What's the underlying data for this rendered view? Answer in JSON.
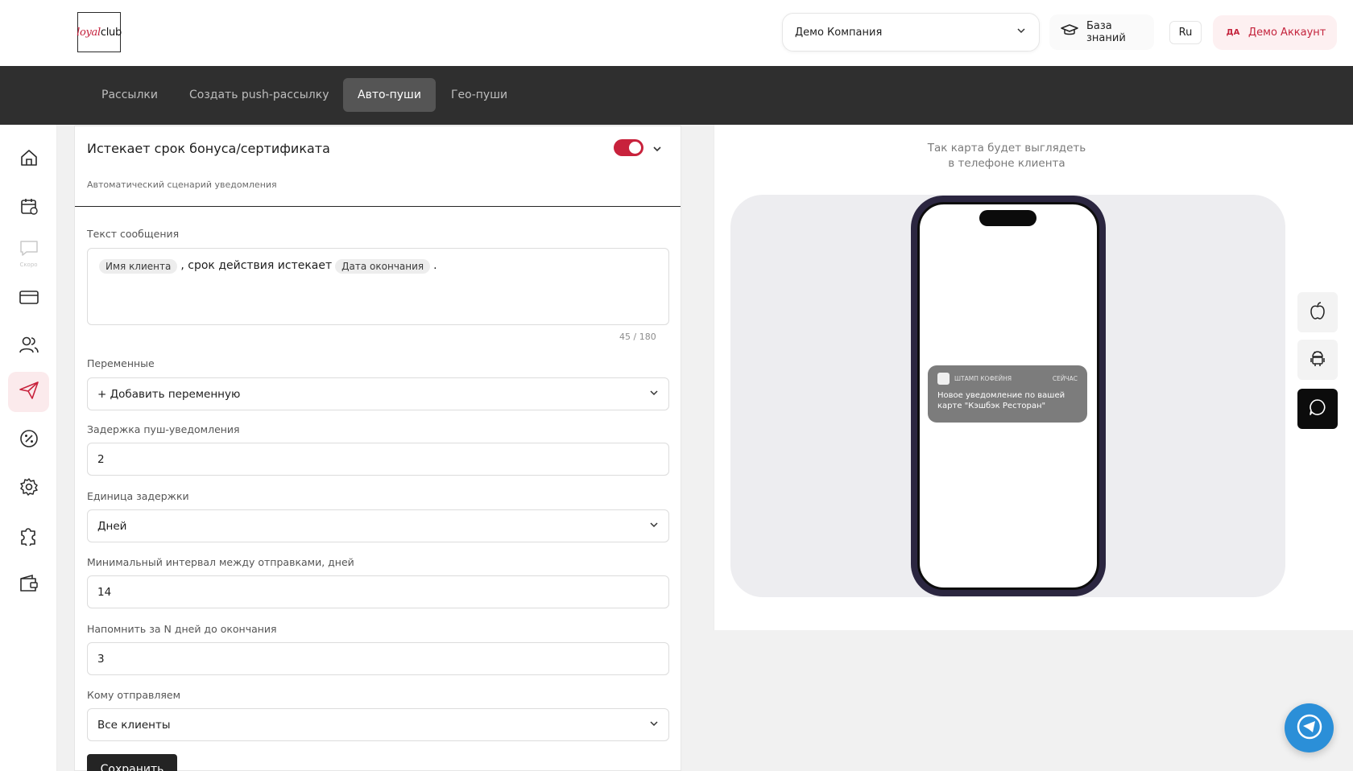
{
  "header": {
    "logo_loyal": "loyal",
    "logo_club": "club",
    "company": "Демо Компания",
    "knowledge_base": "База знаний",
    "language": "Ru",
    "account_initials": "ДА",
    "account_name": "Демо Аккаунт"
  },
  "topnav": {
    "tabs": [
      {
        "label": "Рассылки",
        "active": false
      },
      {
        "label": "Создать push-рассылку",
        "active": false
      },
      {
        "label": "Авто-пуши",
        "active": true
      },
      {
        "label": "Гео-пуши",
        "active": false
      }
    ]
  },
  "sidebar": {
    "items": [
      {
        "icon": "home-icon"
      },
      {
        "icon": "calendar-icon"
      },
      {
        "icon": "chat-icon",
        "soon_label": "Скоро"
      },
      {
        "icon": "card-icon"
      },
      {
        "icon": "users-icon"
      },
      {
        "icon": "send-icon",
        "active": true
      },
      {
        "icon": "percent-icon"
      },
      {
        "icon": "gear-icon"
      },
      {
        "icon": "puzzle-icon"
      },
      {
        "icon": "wallet-icon"
      }
    ]
  },
  "card": {
    "title": "Истекает срок бонуса/сертификата",
    "subtitle": "Автоматический сценарий уведомления",
    "enabled": true,
    "message_label": "Текст сообщения",
    "message": {
      "chip1": "Имя клиента",
      "text": ", срок действия истекает",
      "chip2": "Дата окончания",
      "end": "."
    },
    "counter": "45 / 180",
    "variables_label": "Переменные",
    "variables_value": "+ Добавить переменную",
    "delay_label": "Задержка пуш-уведомления",
    "delay_value": "2",
    "unit_label": "Единица задержки",
    "unit_value": "Дней",
    "interval_label": "Минимальный интервал между отправками, дней",
    "interval_value": "14",
    "remind_label": "Напомнить за N дней до окончания",
    "remind_value": "3",
    "audience_label": "Кому отправляем",
    "audience_value": "Все клиенты",
    "save_label": "Сохранить"
  },
  "preview": {
    "caption_line1": "Так карта будет выглядеть",
    "caption_line2": "в телефоне клиента",
    "notification": {
      "app": "ШТАМП КОФЕЙНЯ",
      "time": "СЕЙЧАС",
      "text": "Новое уведомление по вашей карте \"Кэшбэк Ресторан\""
    },
    "os_buttons": [
      {
        "icon": "apple-icon",
        "active": false
      },
      {
        "icon": "android-icon",
        "active": false
      },
      {
        "icon": "message-icon",
        "active": true
      }
    ]
  },
  "colors": {
    "brand": "#c8223c",
    "nav_bg": "#2f2f2f",
    "telegram": "#2b8fd8"
  }
}
